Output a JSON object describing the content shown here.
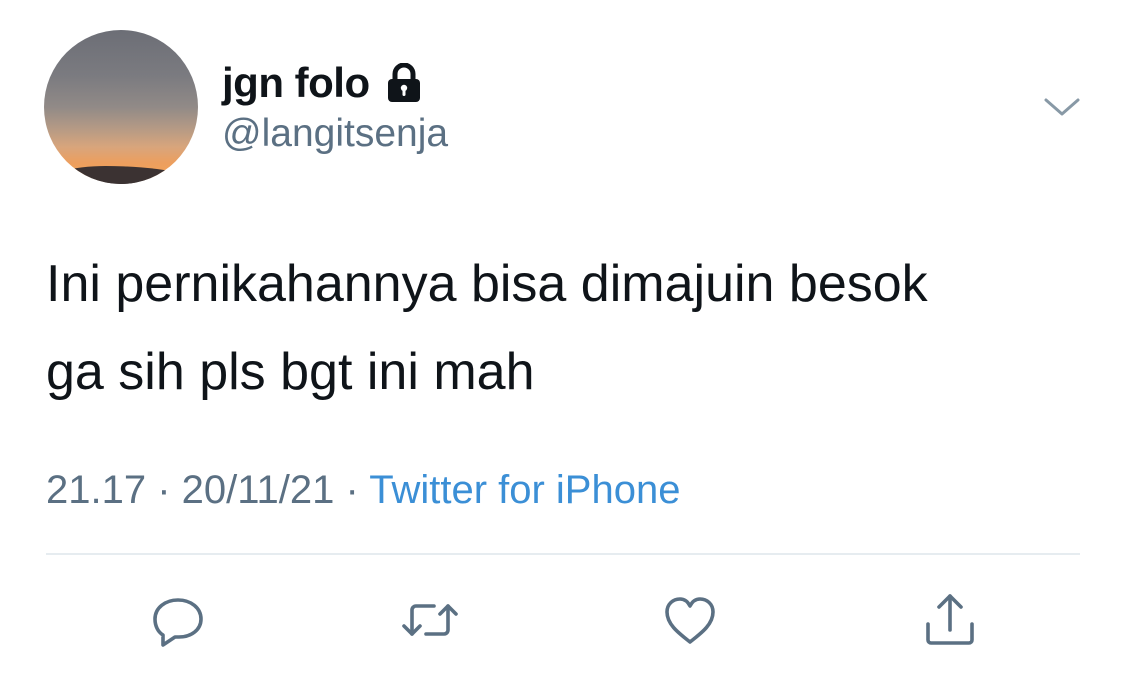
{
  "tweet": {
    "display_name": "jgn folo",
    "handle": "@langitsenja",
    "text_line1": "Ini pernikahannya bisa dimajuin besok",
    "text_line2": "ga sih pls bgt ini mah",
    "time": "21.17",
    "separator1": " · ",
    "date": "20/11/21",
    "separator2": " · ",
    "source": "Twitter for iPhone"
  },
  "icons": {
    "lock": "lock-icon",
    "menu": "chevron-down-icon",
    "reply": "reply-icon",
    "retweet": "retweet-icon",
    "like": "heart-icon",
    "share": "share-icon"
  },
  "colors": {
    "text": "#0f1419",
    "secondary": "#5b7083",
    "link": "#3b8fd6",
    "divider": "#e6ecf0"
  }
}
